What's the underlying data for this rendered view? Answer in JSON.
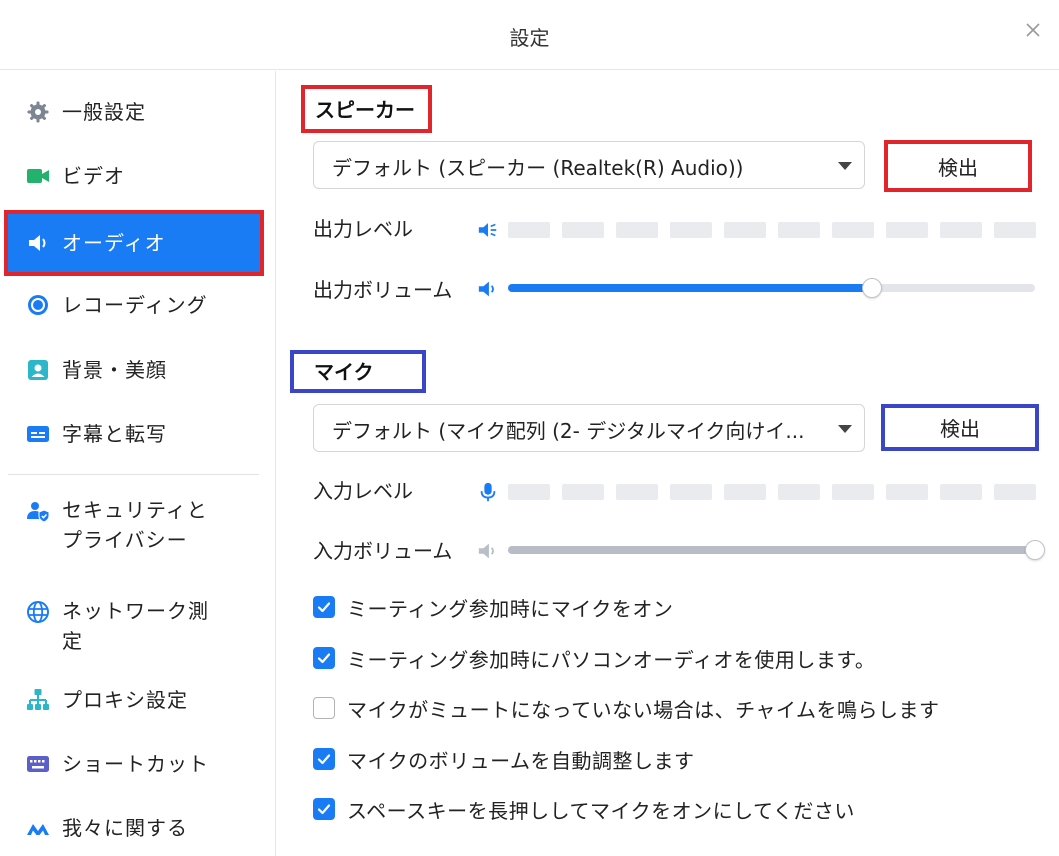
{
  "window": {
    "title": "設定"
  },
  "sidebar": {
    "items": [
      {
        "label": "一般設定",
        "icon": "gear-icon"
      },
      {
        "label": "ビデオ",
        "icon": "video-icon"
      },
      {
        "label": "オーディオ",
        "icon": "speaker-icon",
        "active": true
      },
      {
        "label": "レコーディング",
        "icon": "record-icon"
      },
      {
        "label": "背景・美顔",
        "icon": "portrait-icon"
      },
      {
        "label": "字幕と転写",
        "icon": "caption-icon"
      },
      {
        "label_line1": "セキュリティと",
        "label_line2": "プライバシー",
        "icon": "security-user-icon"
      },
      {
        "label_line1": "ネットワーク測",
        "label_line2": "定",
        "icon": "globe-icon"
      },
      {
        "label": "プロキシ設定",
        "icon": "network-tree-icon"
      },
      {
        "label": "ショートカット",
        "icon": "keyboard-icon"
      },
      {
        "label": "我々に関する",
        "icon": "brand-logo-icon"
      }
    ]
  },
  "speaker": {
    "title": "スピーカー",
    "device": "デフォルト (スピーカー (Realtek(R) Audio))",
    "test_label": "検出",
    "output_level_label": "出力レベル",
    "output_volume_label": "出力ボリューム",
    "output_volume": 0.69
  },
  "mic": {
    "title": "マイク",
    "device": "デフォルト (マイク配列 (2- デジタルマイク向けイ...",
    "test_label": "検出",
    "input_level_label": "入力レベル",
    "input_volume_label": "入力ボリューム",
    "input_volume": 1.0
  },
  "options": [
    {
      "label": "ミーティング参加時にマイクをオン",
      "checked": true
    },
    {
      "label": "ミーティング参加時にパソコンオーディオを使用します。",
      "checked": true
    },
    {
      "label": "マイクがミュートになっていない場合は、チャイムを鳴らします",
      "checked": false
    },
    {
      "label": "マイクのボリュームを自動調整します",
      "checked": true
    },
    {
      "label": "スペースキーを長押ししてマイクをオンにしてください",
      "checked": true
    }
  ],
  "colors": {
    "accent": "#1a7cf5",
    "highlight_red": "#e0262c",
    "highlight_blue": "#3a45c7",
    "icon_green": "#23b26d",
    "icon_teal": "#2bb6c9",
    "icon_indigo": "#5b5fc7"
  }
}
